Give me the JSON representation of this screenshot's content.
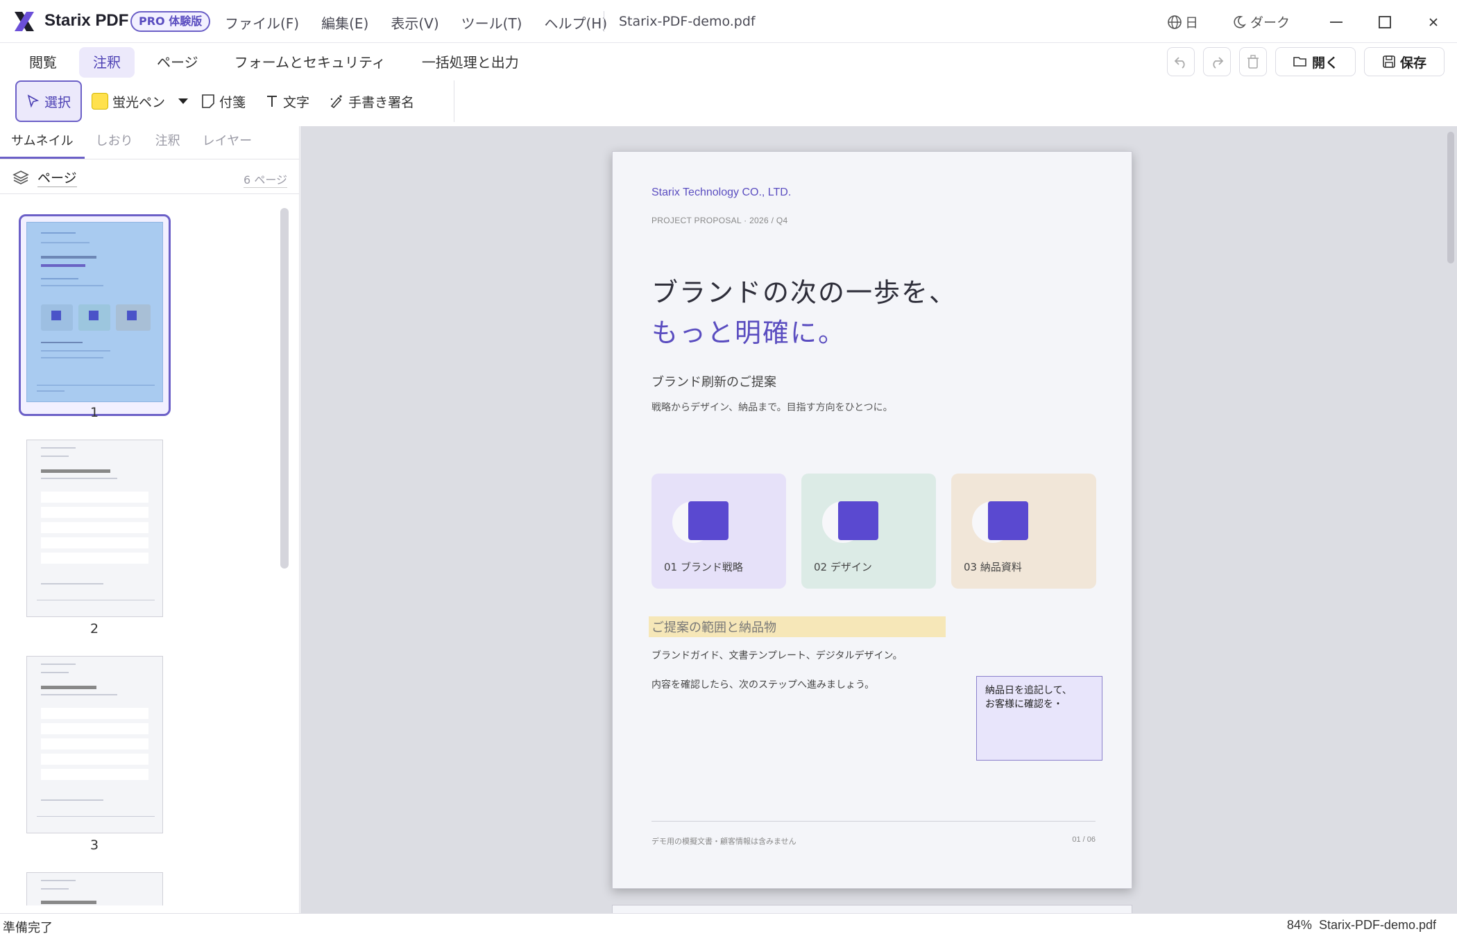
{
  "app": {
    "name": "Starix PDF",
    "badge": "PRO 体験版",
    "document_title": "Starix-PDF-demo.pdf",
    "language": "日",
    "theme": "ダーク"
  },
  "menu": [
    "ファイル(F)",
    "編集(E)",
    "表示(V)",
    "ツール(T)",
    "ヘルプ(H)"
  ],
  "ribbon": {
    "tabs": [
      "閲覧",
      "注釈",
      "ページ",
      "フォームとセキュリティ",
      "一括処理と出力"
    ],
    "active_tab": "注釈",
    "open_label": "開く",
    "save_label": "保存"
  },
  "tools": {
    "select": "選択",
    "highlighter": "蛍光ペン",
    "sticky_note": "付箋",
    "text": "文字",
    "signature": "手書き署名",
    "highlight_color": "#ffe14d"
  },
  "left_panel": {
    "tabs": [
      "サムネイル",
      "しおり",
      "注釈",
      "レイヤー"
    ],
    "active_tab": "サムネイル",
    "page_label": "ページ",
    "page_count": "6 ページ",
    "thumbnails": [
      {
        "number": "1",
        "selected": true
      },
      {
        "number": "2",
        "selected": false
      },
      {
        "number": "3",
        "selected": false
      }
    ]
  },
  "page": {
    "company": "Starix Technology CO., LTD.",
    "meta": "PROJECT PROPOSAL   ·   2026 / Q4",
    "headline_line1": "ブランドの次の一歩を、",
    "headline_line2": "もっと明確に。",
    "subtitle": "ブランド刷新のご提案",
    "description": "戦略からデザイン、納品まで。目指す方向をひとつに。",
    "cards": [
      {
        "label": "01  ブランド戦略",
        "color": "#e6e1f9"
      },
      {
        "label": "02  デザイン",
        "color": "#dcebe6"
      },
      {
        "label": "03  納品資料",
        "color": "#f1e6d8"
      }
    ],
    "highlighted_heading": "ご提案の範囲と納品物",
    "body_line1": "ブランドガイド、文書テンプレート、デジタルデザイン。",
    "body_line2": "内容を確認したら、次のステップへ進みましょう。",
    "sticky_note": "納品日を追記して、\nお客様に確認を・",
    "footer_left": "デモ用の模擬文書・顧客情報は含みません",
    "footer_right": "01 / 06"
  },
  "status": {
    "left": "準備完了",
    "zoom": "84%",
    "file": "Starix-PDF-demo.pdf"
  },
  "colors": {
    "accent": "#5a4dc0",
    "accent_light": "#ece9fb",
    "highlight": "#f6e7b8",
    "note_bg": "#e8e5fb"
  }
}
